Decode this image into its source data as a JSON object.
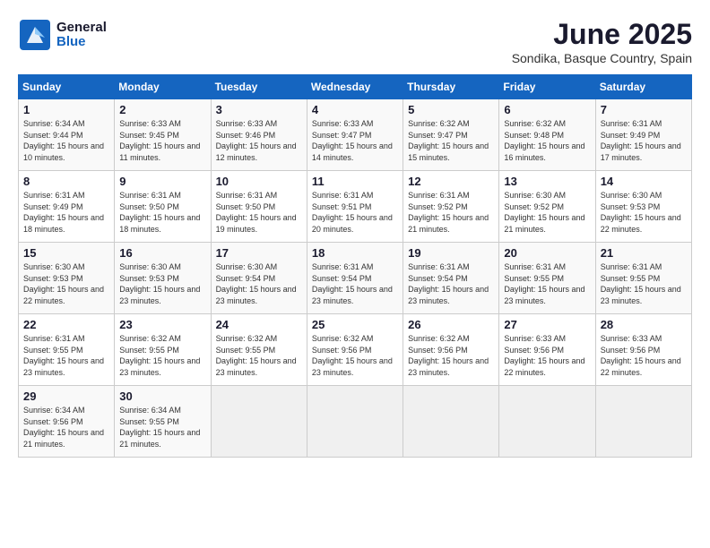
{
  "logo": {
    "general": "General",
    "blue": "Blue"
  },
  "title": "June 2025",
  "location": "Sondika, Basque Country, Spain",
  "headers": [
    "Sunday",
    "Monday",
    "Tuesday",
    "Wednesday",
    "Thursday",
    "Friday",
    "Saturday"
  ],
  "weeks": [
    [
      {
        "day": "1",
        "sunrise": "6:34 AM",
        "sunset": "9:44 PM",
        "daylight": "15 hours and 10 minutes."
      },
      {
        "day": "2",
        "sunrise": "6:33 AM",
        "sunset": "9:45 PM",
        "daylight": "15 hours and 11 minutes."
      },
      {
        "day": "3",
        "sunrise": "6:33 AM",
        "sunset": "9:46 PM",
        "daylight": "15 hours and 12 minutes."
      },
      {
        "day": "4",
        "sunrise": "6:33 AM",
        "sunset": "9:47 PM",
        "daylight": "15 hours and 14 minutes."
      },
      {
        "day": "5",
        "sunrise": "6:32 AM",
        "sunset": "9:47 PM",
        "daylight": "15 hours and 15 minutes."
      },
      {
        "day": "6",
        "sunrise": "6:32 AM",
        "sunset": "9:48 PM",
        "daylight": "15 hours and 16 minutes."
      },
      {
        "day": "7",
        "sunrise": "6:31 AM",
        "sunset": "9:49 PM",
        "daylight": "15 hours and 17 minutes."
      }
    ],
    [
      {
        "day": "8",
        "sunrise": "6:31 AM",
        "sunset": "9:49 PM",
        "daylight": "15 hours and 18 minutes."
      },
      {
        "day": "9",
        "sunrise": "6:31 AM",
        "sunset": "9:50 PM",
        "daylight": "15 hours and 18 minutes."
      },
      {
        "day": "10",
        "sunrise": "6:31 AM",
        "sunset": "9:50 PM",
        "daylight": "15 hours and 19 minutes."
      },
      {
        "day": "11",
        "sunrise": "6:31 AM",
        "sunset": "9:51 PM",
        "daylight": "15 hours and 20 minutes."
      },
      {
        "day": "12",
        "sunrise": "6:31 AM",
        "sunset": "9:52 PM",
        "daylight": "15 hours and 21 minutes."
      },
      {
        "day": "13",
        "sunrise": "6:30 AM",
        "sunset": "9:52 PM",
        "daylight": "15 hours and 21 minutes."
      },
      {
        "day": "14",
        "sunrise": "6:30 AM",
        "sunset": "9:53 PM",
        "daylight": "15 hours and 22 minutes."
      }
    ],
    [
      {
        "day": "15",
        "sunrise": "6:30 AM",
        "sunset": "9:53 PM",
        "daylight": "15 hours and 22 minutes."
      },
      {
        "day": "16",
        "sunrise": "6:30 AM",
        "sunset": "9:53 PM",
        "daylight": "15 hours and 23 minutes."
      },
      {
        "day": "17",
        "sunrise": "6:30 AM",
        "sunset": "9:54 PM",
        "daylight": "15 hours and 23 minutes."
      },
      {
        "day": "18",
        "sunrise": "6:31 AM",
        "sunset": "9:54 PM",
        "daylight": "15 hours and 23 minutes."
      },
      {
        "day": "19",
        "sunrise": "6:31 AM",
        "sunset": "9:54 PM",
        "daylight": "15 hours and 23 minutes."
      },
      {
        "day": "20",
        "sunrise": "6:31 AM",
        "sunset": "9:55 PM",
        "daylight": "15 hours and 23 minutes."
      },
      {
        "day": "21",
        "sunrise": "6:31 AM",
        "sunset": "9:55 PM",
        "daylight": "15 hours and 23 minutes."
      }
    ],
    [
      {
        "day": "22",
        "sunrise": "6:31 AM",
        "sunset": "9:55 PM",
        "daylight": "15 hours and 23 minutes."
      },
      {
        "day": "23",
        "sunrise": "6:32 AM",
        "sunset": "9:55 PM",
        "daylight": "15 hours and 23 minutes."
      },
      {
        "day": "24",
        "sunrise": "6:32 AM",
        "sunset": "9:55 PM",
        "daylight": "15 hours and 23 minutes."
      },
      {
        "day": "25",
        "sunrise": "6:32 AM",
        "sunset": "9:56 PM",
        "daylight": "15 hours and 23 minutes."
      },
      {
        "day": "26",
        "sunrise": "6:32 AM",
        "sunset": "9:56 PM",
        "daylight": "15 hours and 23 minutes."
      },
      {
        "day": "27",
        "sunrise": "6:33 AM",
        "sunset": "9:56 PM",
        "daylight": "15 hours and 22 minutes."
      },
      {
        "day": "28",
        "sunrise": "6:33 AM",
        "sunset": "9:56 PM",
        "daylight": "15 hours and 22 minutes."
      }
    ],
    [
      {
        "day": "29",
        "sunrise": "6:34 AM",
        "sunset": "9:56 PM",
        "daylight": "15 hours and 21 minutes."
      },
      {
        "day": "30",
        "sunrise": "6:34 AM",
        "sunset": "9:55 PM",
        "daylight": "15 hours and 21 minutes."
      },
      null,
      null,
      null,
      null,
      null
    ]
  ]
}
